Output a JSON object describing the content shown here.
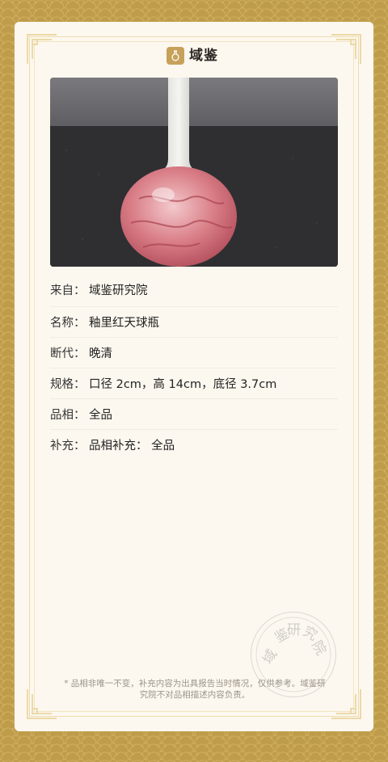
{
  "brand": {
    "name": "域鉴",
    "tagline": "",
    "logo_icon": "vase-logo-icon"
  },
  "photo": {
    "subject": "vase-photo"
  },
  "fields": [
    {
      "label": "来自：",
      "value": "域鉴研究院"
    },
    {
      "label": "名称：",
      "value": "釉里红天球瓶"
    },
    {
      "label": "断代：",
      "value": "晚清"
    },
    {
      "label": "规格：",
      "value": "口径 2cm，高 14cm，底径 3.7cm"
    },
    {
      "label": "品相：",
      "value": "全品"
    },
    {
      "label": "补充：",
      "value": "品相补充： 全品"
    }
  ],
  "seal": {
    "chars": [
      "域",
      "鉴",
      "研",
      "究",
      "院"
    ]
  },
  "footer": {
    "note": "* 品相非唯一不变，补充内容为出具报告当时情况，仅供参考。域鉴研究院不对品相描述内容负责。"
  },
  "colors": {
    "background": "#bf9c4a",
    "card": "#fdf8ef",
    "frame": "#eedcae",
    "logo": "#c7a15a"
  }
}
